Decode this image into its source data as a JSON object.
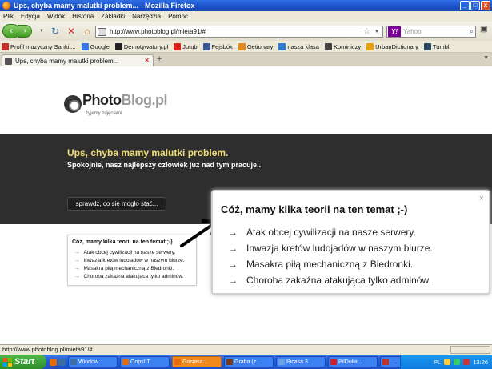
{
  "window": {
    "title": "Ups, chyba mamy malutki problem... - Mozilla Firefox",
    "buttons": [
      "_",
      "□",
      "x"
    ]
  },
  "menu": [
    "Plik",
    "Edycja",
    "Widok",
    "Historia",
    "Zakładki",
    "Narzędzia",
    "Pomoc"
  ],
  "navbar": {
    "url": "http://www.photoblog.pl/mieta91/#",
    "search_placeholder": "Yahoo",
    "search_engine": "Y!"
  },
  "bookmarks": [
    {
      "label": "Profil muzyczny Sankit...",
      "color": "#c0302a"
    },
    {
      "label": "Google",
      "color": "#3b78e7"
    },
    {
      "label": "Demotywatory.pl",
      "color": "#222222"
    },
    {
      "label": "Jutub",
      "color": "#d8261c"
    },
    {
      "label": "Fejsbók",
      "color": "#3b5998"
    },
    {
      "label": "Getionary",
      "color": "#e08a1e"
    },
    {
      "label": "nasza klasa",
      "color": "#2a7bd0"
    },
    {
      "label": "Kominiczy",
      "color": "#444444"
    },
    {
      "label": "UrbanDictionary",
      "color": "#e6a010"
    },
    {
      "label": "Tumblr",
      "color": "#2c4762"
    }
  ],
  "tab": {
    "label": "Ups, chyba mamy malutki problem...",
    "new_tab": "+"
  },
  "page": {
    "logo_photo": "Photo",
    "logo_blog": "Blog.pl",
    "logo_tagline": "żyjemy zdjęciami",
    "error_title": "Ups, chyba mamy malutki problem.",
    "error_subtitle": "Spokojnie, nasz najlepszy człowiek już nad tym pracuje..",
    "check_button": "sprawdź, co się mogło stać...",
    "theories_title": "Cóż, mamy kilka teorii na ten temat ;-)",
    "theories": [
      "Atak obcej cywilizacji na nasze serwery.",
      "Inwazja kretów ludojadów w naszym biurze.",
      "Masakra piłą mechaniczną z Biedronki.",
      "Choroba zakaźna atakująca tylko adminów."
    ],
    "close_symbol": "×",
    "arrow_symbol": "→"
  },
  "status": {
    "text": "http://www.photoblog.pl/mieta91/#"
  },
  "taskbar": {
    "start_label": "Start",
    "tasks": [
      {
        "label": "Window...",
        "color": "#3a6ea5",
        "active": false
      },
      {
        "label": "Oops! T...",
        "color": "#e56b0b",
        "active": false
      },
      {
        "label": "Gosiasa...",
        "color": "#e56b0b",
        "active": true
      },
      {
        "label": "Graba (z...",
        "color": "#7a3a1a",
        "active": false
      },
      {
        "label": "Picasa 3",
        "color": "#6aa0e8",
        "active": false
      },
      {
        "label": "PilDulia...",
        "color": "#d0202a",
        "active": false
      },
      {
        "label": "...",
        "color": "#c0302a",
        "active": false
      }
    ],
    "lang": "PL",
    "time": "13:26"
  }
}
